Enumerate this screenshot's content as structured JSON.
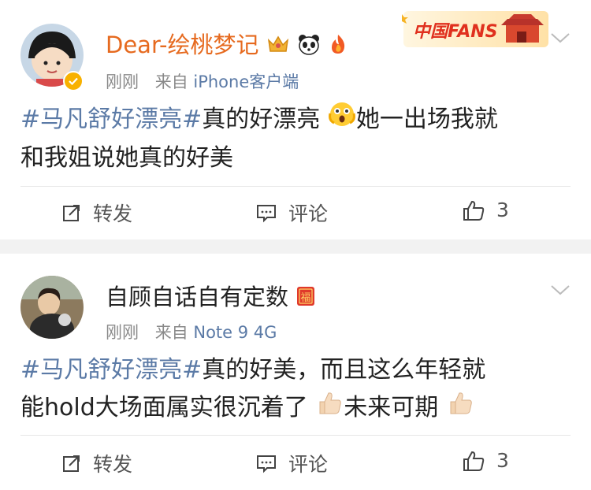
{
  "posts": [
    {
      "username": "Dear-绘桃梦记",
      "time": "刚刚",
      "source_prefix": "来自",
      "device": "iPhone客户端",
      "hashtag": "#马凡舒好漂亮#",
      "text_line1": "真的好漂亮",
      "text_line1_after": "她一出场我就",
      "text_line2": "和我姐说她真的好美",
      "badge_text": "中国FANS",
      "actions": {
        "repost": "转发",
        "comment": "评论",
        "like_count": "3"
      }
    },
    {
      "username": "自顾自话自有定数",
      "time": "刚刚",
      "source_prefix": "来自",
      "device": "Note 9 4G",
      "hashtag": "#马凡舒好漂亮#",
      "text_line1": "真的好美，而且这么年轻就",
      "text_line2": "能hold大场面属实很沉着了",
      "text_line2_after": "未来可期",
      "actions": {
        "repost": "转发",
        "comment": "评论",
        "like_count": "3"
      }
    }
  ],
  "colors": {
    "link": "#5b7aa6",
    "username_vip": "#e66a1f",
    "verified": "#f8b100",
    "background": "#f2f2f2"
  },
  "icons": [
    "crown-icon",
    "panda-icon",
    "flame-icon",
    "fu-icon",
    "thumbs-up-emoji",
    "shocked-emoji",
    "repost-icon",
    "comment-icon",
    "like-icon",
    "chevron-down-icon"
  ]
}
